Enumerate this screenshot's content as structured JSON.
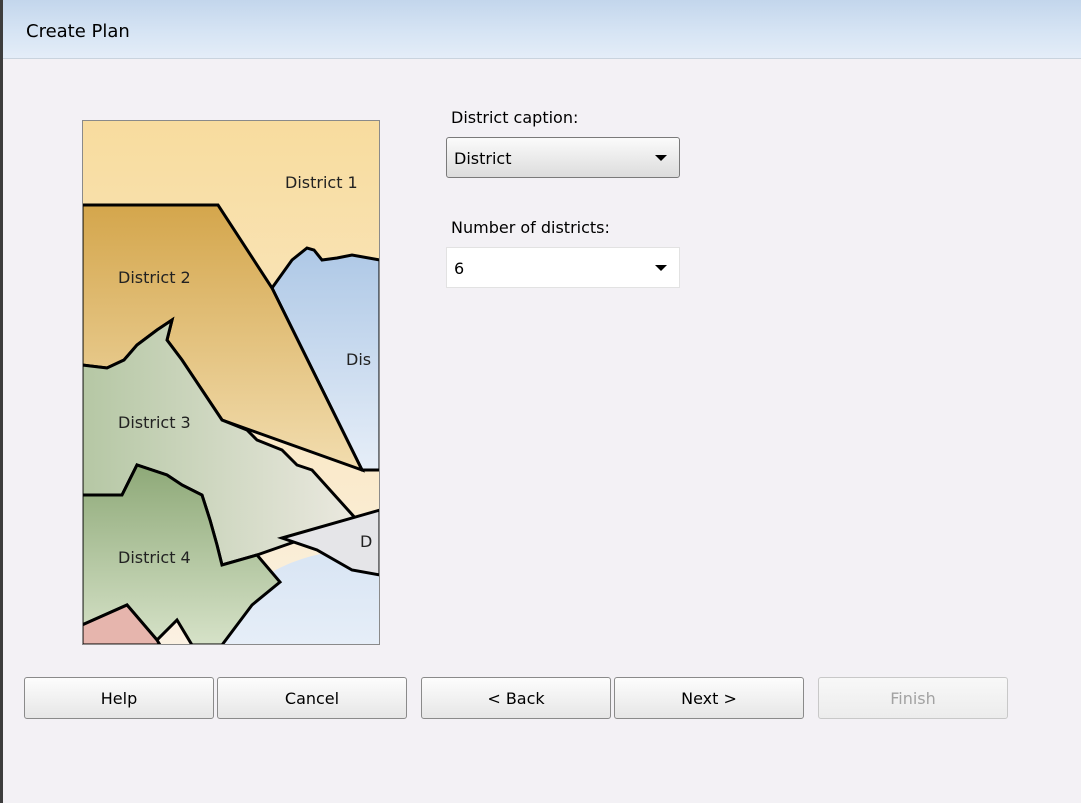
{
  "window": {
    "title": "Create Plan"
  },
  "preview": {
    "district_labels": [
      "District 1",
      "District 2",
      "Dis",
      "District 3",
      "D",
      "District 4"
    ]
  },
  "form": {
    "caption_label": "District caption:",
    "caption_value": "District",
    "count_label": "Number of districts:",
    "count_value": "6"
  },
  "buttons": {
    "help": "Help",
    "cancel": "Cancel",
    "back": "< Back",
    "next": "Next >",
    "finish": "Finish"
  },
  "icons": {
    "dropdown": "chevron-down-icon"
  }
}
